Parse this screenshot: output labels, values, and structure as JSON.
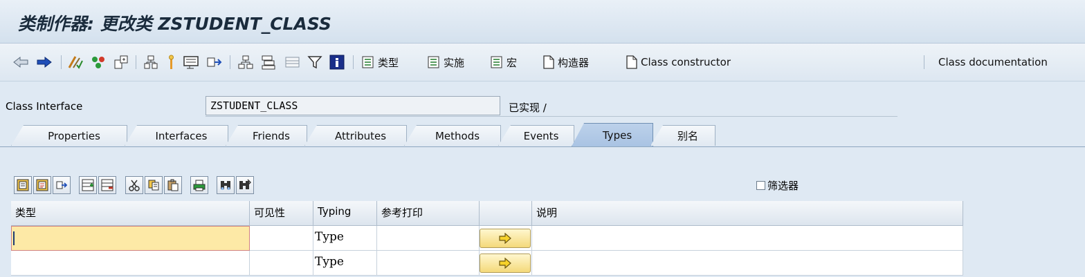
{
  "window": {
    "title": "类制作器: 更改类 ZSTUDENT_CLASS"
  },
  "toolbar": {
    "text_buttons": [
      {
        "label": "类型"
      },
      {
        "label": "实施"
      },
      {
        "label": "宏"
      },
      {
        "label": "构造器"
      },
      {
        "label": "Class constructor"
      },
      {
        "label": "Class documentation"
      }
    ]
  },
  "header": {
    "class_interface_label": "Class Interface",
    "class_interface_value": "ZSTUDENT_CLASS",
    "status": "已实现 /"
  },
  "tabs": [
    {
      "label": "Properties"
    },
    {
      "label": "Interfaces"
    },
    {
      "label": "Friends"
    },
    {
      "label": "Attributes"
    },
    {
      "label": "Methods"
    },
    {
      "label": "Events"
    },
    {
      "label": "Types",
      "active": true
    },
    {
      "label": "别名"
    }
  ],
  "types_panel": {
    "filter_label": "筛选器",
    "filter_checked": false,
    "columns": [
      "类型",
      "可见性",
      "Typing",
      "参考打印",
      "",
      "说明"
    ],
    "rows": [
      {
        "type": "",
        "visibility": "",
        "typing": "Type",
        "ref": "",
        "desc": ""
      },
      {
        "type": "",
        "visibility": "",
        "typing": "Type",
        "ref": "",
        "desc": ""
      }
    ]
  },
  "colors": {
    "accent": "#a9c3e3",
    "active_cell": "#fde9a6",
    "arrow_button": "#f4d97a"
  }
}
